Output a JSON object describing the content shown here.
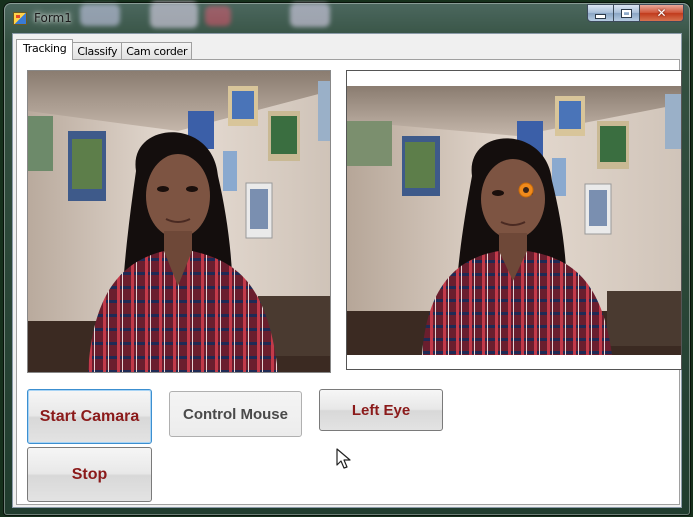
{
  "window": {
    "title": "Form1",
    "icon": "form-app-icon",
    "controls": {
      "minimize": "minimize-icon",
      "maximize": "maximize-icon",
      "close": "close-icon"
    },
    "close_glyph": "✕"
  },
  "tabs": [
    {
      "label": "Tracking",
      "active": true
    },
    {
      "label": "Classify",
      "active": false
    },
    {
      "label": "Cam corder",
      "active": false
    }
  ],
  "tracking": {
    "left_view": {
      "content": "webcam-frame"
    },
    "right_view": {
      "content": "webcam-frame",
      "marker_color": "#f08a1c"
    },
    "buttons": {
      "start": "Start Camara",
      "stop": "Stop",
      "control": "Control Mouse",
      "left_eye": "Left Eye"
    }
  },
  "colors": {
    "button_text": "#8b1a1a",
    "button_text_muted": "#4a4a4a",
    "focus_border": "#3c8fd0",
    "marker": "#f08a1c"
  }
}
